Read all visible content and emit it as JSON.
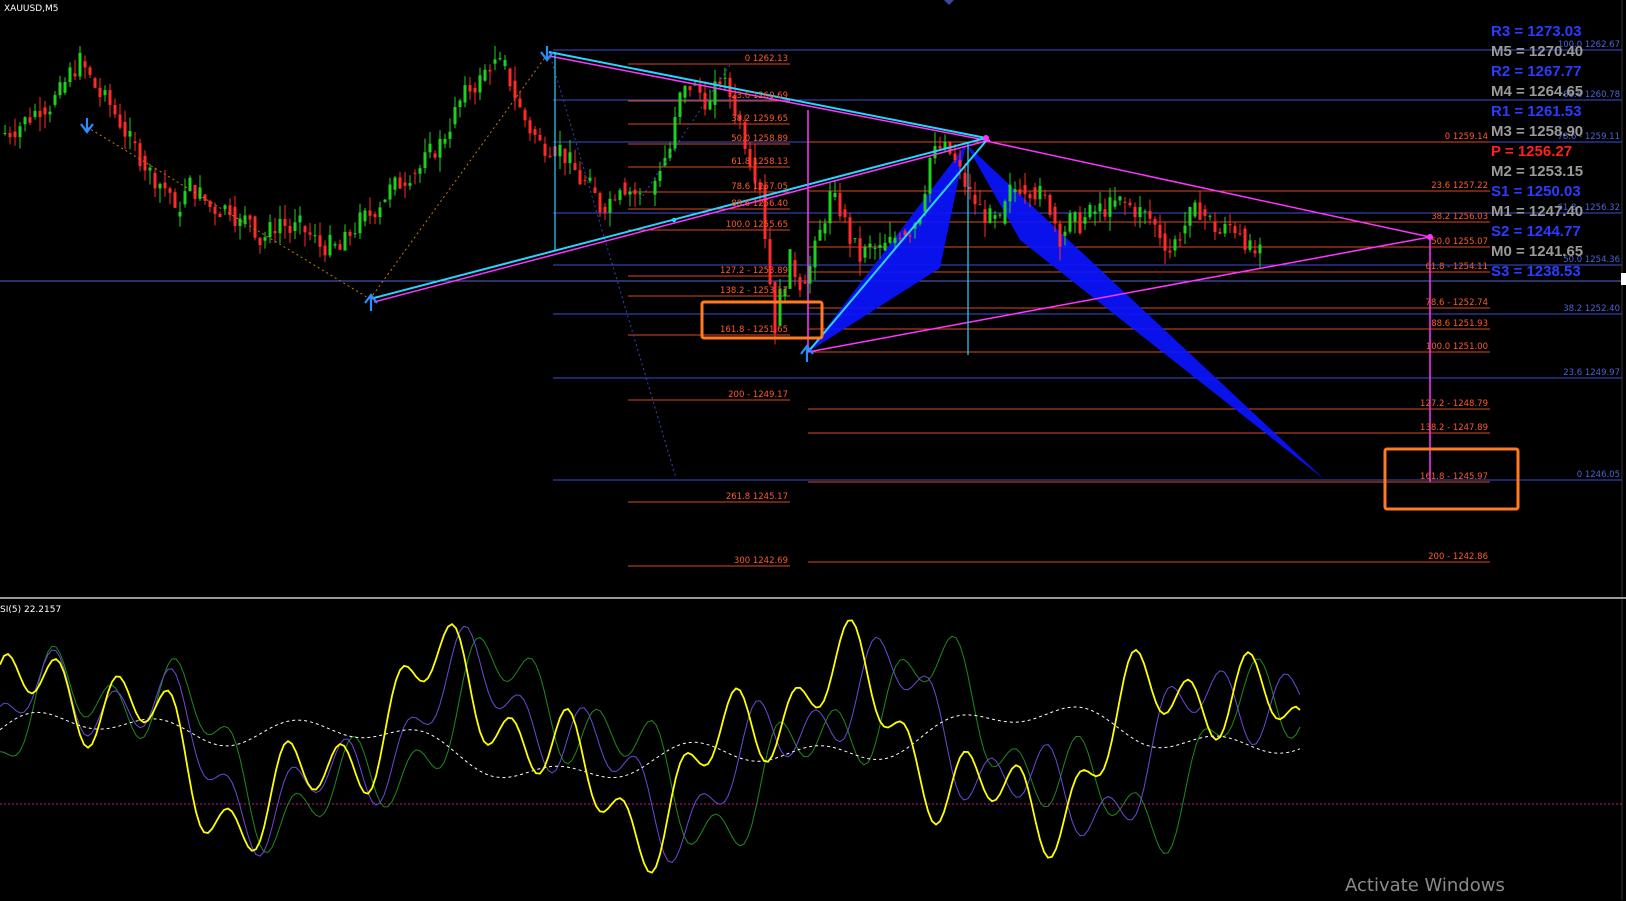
{
  "chart": {
    "symbol_label": "XAUUSD,M5",
    "indicator_label": "SI(5) 22.2157",
    "watermark": "Activate Windows"
  },
  "colors": {
    "background": "#000000",
    "bull": "#1fd11f",
    "bear": "#ff2a2a",
    "fib_upper": "#ff5a2a",
    "fib_blue": "#4c63d6",
    "pattern_fill": "#0a12ff",
    "trend_magenta": "#ff35ff",
    "trend_cyan": "#2ad4ff",
    "highlight_box": "#ff7a22",
    "oscillator_main": "#ffff00",
    "pivot_blue": "#2a3cff",
    "pivot_gray": "#9a9a9a",
    "pivot_red": "#ff2020"
  },
  "pivots": [
    {
      "label": "R3 = 1273.03",
      "color": "blue"
    },
    {
      "label": "M5 = 1270.40",
      "color": "gray"
    },
    {
      "label": "R2 = 1267.77",
      "color": "blue"
    },
    {
      "label": "M4 = 1264.65",
      "color": "gray"
    },
    {
      "label": "R1 = 1261.53",
      "color": "blue"
    },
    {
      "label": "M3 = 1258.90",
      "color": "gray"
    },
    {
      "label": "P  = 1256.27",
      "color": "red"
    },
    {
      "label": "M2 = 1253.15",
      "color": "gray"
    },
    {
      "label": "S1 = 1250.03",
      "color": "blue"
    },
    {
      "label": "M1 = 1247.40",
      "color": "gray"
    },
    {
      "label": "S2 = 1244.77",
      "color": "blue"
    },
    {
      "label": "M0 = 1241.65",
      "color": "gray"
    },
    {
      "label": "S3 = 1238.53",
      "color": "blue"
    }
  ],
  "fib_left": [
    "0 1262.13",
    "23.6 1260.69",
    "38.2 1259.65",
    "50.0 1258.89",
    "61.8 1258.13",
    "78.6 1257.05",
    "88.6 1256.40",
    "100.0 1255.65",
    "127.2 - 1253.89",
    "138.2 - 1253.17",
    "161.8 - 1251.65",
    "200 - 1249.17",
    "261.8 1245.17",
    "300 1242.69"
  ],
  "fib_right": [
    "0 1259.14",
    "23.6 1257.22",
    "38.2 1256.03",
    "50.0 1255.07",
    "61.8 - 1254.11",
    "78.6 - 1252.74",
    "88.6 1251.93",
    "100.0 1251.00",
    "127.2 - 1248.79",
    "138.2 - 1247.89",
    "161.8 - 1245.97",
    "200 - 1242.86"
  ],
  "fib_blue": [
    "100.0 1262.67",
    "88.6 1260.78",
    "78.6 - 1259.11",
    "61.8 - 1256.32",
    "50.0 1254.36",
    "38.2 1252.40",
    "23.6 1249.97",
    "0 1246.05"
  ],
  "chart_data": {
    "type": "line",
    "title": "XAUUSD,M5",
    "xlabel": "",
    "ylabel": "",
    "ylim": [
      1240.5,
      1264.0
    ],
    "series": [
      {
        "name": "XAUUSD,M5",
        "x": [
          0,
          10,
          20,
          30,
          40,
          50,
          60,
          70,
          80,
          90,
          100,
          110,
          120,
          130,
          140,
          150,
          160,
          170,
          175,
          180,
          190,
          200,
          210,
          220,
          230,
          240,
          250,
          260,
          270,
          280,
          290,
          300,
          310,
          320,
          330,
          340,
          350,
          360,
          370,
          380,
          390,
          400,
          410,
          420,
          430,
          440,
          450,
          460,
          470,
          480,
          490,
          500,
          505,
          510,
          520,
          530,
          540,
          550,
          560,
          570,
          580,
          590,
          600,
          610,
          620,
          630,
          640
        ],
        "values": [
          1259.3,
          1259.4,
          1259.7,
          1260.0,
          1260.4,
          1260.5,
          1261.0,
          1261.8,
          1262.3,
          1261.6,
          1260.9,
          1260.5,
          1259.8,
          1259.0,
          1258.4,
          1257.7,
          1257.3,
          1256.9,
          1255.9,
          1256.4,
          1257.2,
          1256.8,
          1256.3,
          1256.2,
          1256.3,
          1255.6,
          1255.9,
          1254.9,
          1255.3,
          1255.8,
          1255.3,
          1255.5,
          1255.1,
          1254.7,
          1254.7,
          1254.5,
          1255.2,
          1255.7,
          1256.0,
          1256.5,
          1257.0,
          1257.3,
          1257.7,
          1257.9,
          1258.5,
          1258.9,
          1259.7,
          1260.6,
          1261.2,
          1261.5,
          1262.2,
          1262.1,
          1262.0,
          1261.5,
          1260.3,
          1259.5,
          1258.9,
          1258.8,
          1258.7,
          1258.1,
          1257.4,
          1257.1,
          1256.3,
          1256.6,
          1257.3,
          1257.0,
          1256.7
        ]
      },
      {
        "name": "XAUUSD,M5",
        "x": [
          650,
          660,
          670,
          680,
          690,
          700,
          710,
          720,
          730,
          740,
          750,
          760,
          770,
          775,
          780,
          790,
          800,
          810,
          820,
          830,
          840,
          850,
          860,
          870,
          880,
          890,
          900,
          910,
          920,
          930,
          940,
          950,
          960,
          970,
          980,
          990,
          1000,
          1010,
          1020,
          1030,
          1040,
          1050,
          1060,
          1070,
          1080,
          1090,
          1100,
          1110,
          1120,
          1130,
          1140,
          1150,
          1160,
          1170,
          1180,
          1190,
          1200,
          1210,
          1220,
          1230,
          1240,
          1250,
          1260
        ],
        "values": [
          1256.8,
          1258.0,
          1258.7,
          1260.8,
          1261.3,
          1261.0,
          1260.5,
          1261.6,
          1260.9,
          1259.8,
          1258.3,
          1257.2,
          1253.2,
          1251.4,
          1252.6,
          1254.1,
          1253.2,
          1253.8,
          1255.2,
          1256.7,
          1256.2,
          1255.0,
          1254.2,
          1254.6,
          1254.5,
          1254.8,
          1255.3,
          1255.4,
          1256.1,
          1258.3,
          1258.7,
          1258.5,
          1257.7,
          1256.8,
          1256.2,
          1255.8,
          1255.6,
          1256.9,
          1257.2,
          1257.1,
          1256.8,
          1256.3,
          1255.1,
          1255.7,
          1255.6,
          1256.0,
          1256.2,
          1256.3,
          1256.5,
          1256.3,
          1256.1,
          1255.8,
          1255.2,
          1254.5,
          1255.2,
          1255.9,
          1256.2,
          1255.7,
          1255.2,
          1255.5,
          1255.4,
          1254.5,
          1254.3
        ]
      }
    ]
  }
}
